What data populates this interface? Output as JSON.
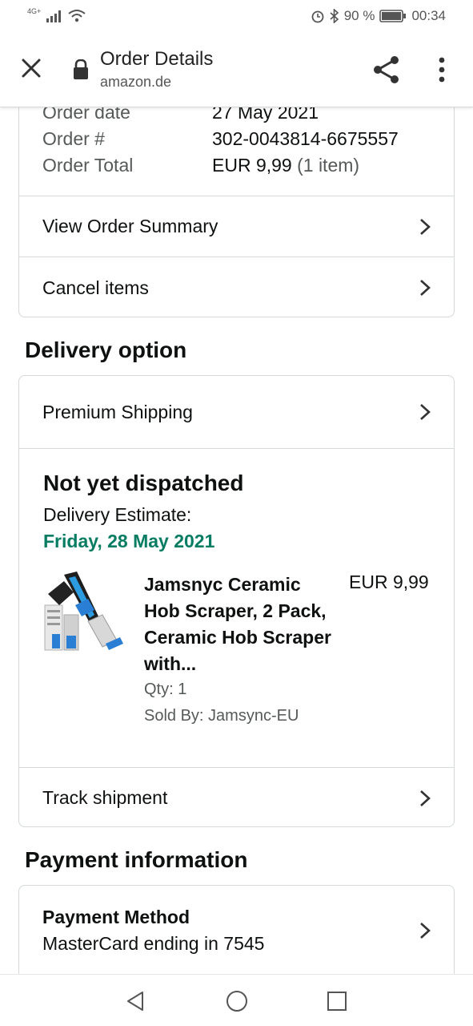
{
  "status_bar": {
    "network": "4G+",
    "battery": "90 %",
    "time": "00:34"
  },
  "toolbar": {
    "title": "Order Details",
    "domain": "amazon.de"
  },
  "order_info": {
    "date_label": "Order date",
    "date_value": "27 May 2021",
    "number_label": "Order #",
    "number_value": "302-0043814-6675557",
    "total_label": "Order Total",
    "total_value": "EUR 9,99",
    "total_items": "(1 item)"
  },
  "actions": {
    "view_summary": "View Order Summary",
    "cancel_items": "Cancel items"
  },
  "delivery": {
    "heading": "Delivery option",
    "shipping": "Premium Shipping",
    "status": "Not yet dispatched",
    "estimate_label": "Delivery Estimate:",
    "estimate_date": "Friday, 28 May 2021",
    "track": "Track shipment"
  },
  "product": {
    "name": "Jamsnyc Ceramic Hob Scraper, 2 Pack, Ceramic Hob Scraper with...",
    "price": "EUR 9,99",
    "qty": "Qty: 1",
    "seller": "Sold By: Jamsync-EU"
  },
  "payment": {
    "heading": "Payment information",
    "method_label": "Payment Method",
    "method_value": "MasterCard ending in 7545"
  },
  "colors": {
    "accent_green": "#067d62",
    "border": "#d5d9d9",
    "text": "#0f1111",
    "muted": "#565959"
  },
  "icons": [
    "signal-icon",
    "wifi-icon",
    "alarm-icon",
    "bluetooth-icon",
    "battery-icon",
    "close-icon",
    "lock-icon",
    "share-icon",
    "more-icon",
    "chevron-right-icon",
    "back-icon",
    "home-icon",
    "recents-icon"
  ]
}
